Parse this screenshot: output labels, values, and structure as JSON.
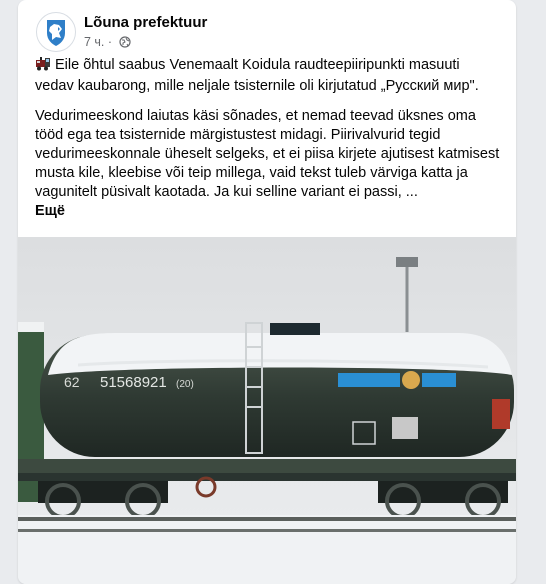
{
  "post": {
    "page_name": "Lõuna prefektuur",
    "time": "7 ч.",
    "separator": "·",
    "paragraph1": "Eile õhtul saabus Venemaalt Koidula raudteepiiripunkti masuuti vedav kaubarong, mille neljale tsisternile oli kirjutatud „Русский мир\".",
    "paragraph2": "Vedurimeeskond laiutas käsi sõnades, et nemad teevad üksnes oma tööd ega tea tsisternide märgistustest midagi. Piirivalvurid tegid vedurimeeskonnale üheselt selgeks, et ei piisa kirjete ajutisest katmisest musta kile, kleebise või teip millega, vaid tekst tuleb värviga katta ja vagunitelt püsivalt kaotada. Ja kui selline variant ei passi, ...",
    "see_more": "Ещё",
    "icons": [
      "logo-icon",
      "globe-icon",
      "train-icon"
    ]
  },
  "photo": {
    "tank_number": "51568921",
    "tank_code": "(20)",
    "tank_left_number": "62",
    "colors": {
      "tank": "#2f3a33",
      "snow": "#f2f4f6",
      "blue_patch": "#2a8fd4",
      "sky": "#e2e4e6"
    }
  }
}
